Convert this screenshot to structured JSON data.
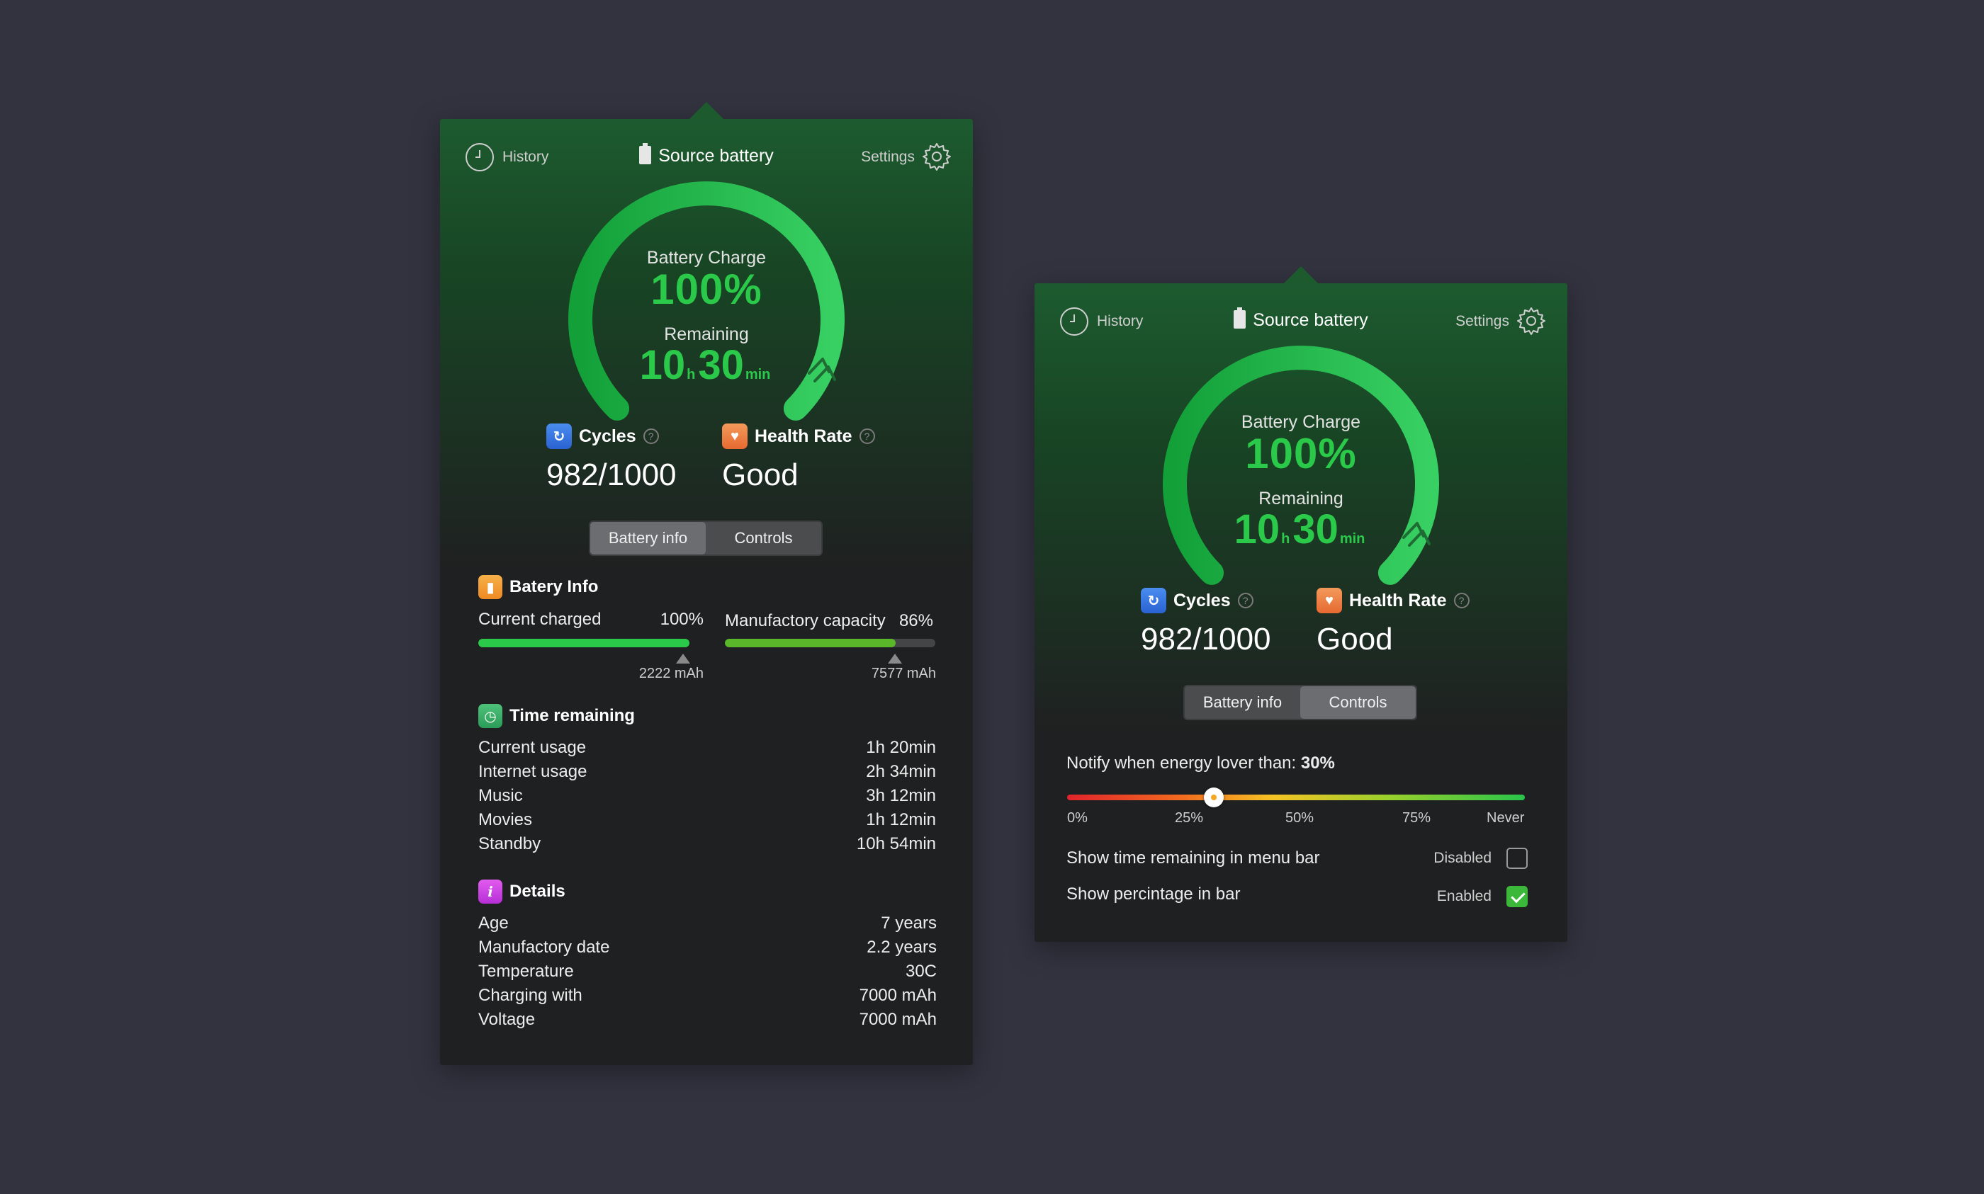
{
  "theme": {
    "accent_green": "#2bc94a",
    "background": "#32333f",
    "panel": "#1f2021",
    "header_green": "#1d5b2f"
  },
  "header": {
    "history_label": "History",
    "title": "Source battery",
    "settings_label": "Settings",
    "history_icon": "clock-icon",
    "title_icon": "battery-icon",
    "settings_icon": "gear-icon"
  },
  "gauge": {
    "charge_label": "Battery Charge",
    "charge_value": "100%",
    "charge_fraction": 1.0,
    "remaining_label": "Remaining",
    "hours": "10",
    "hours_unit": "h",
    "minutes": "30",
    "minutes_unit": "min"
  },
  "stats": {
    "cycles_label": "Cycles",
    "cycles_value": "982/1000",
    "cycles_icon": "cycles-icon",
    "health_label": "Health Rate",
    "health_value": "Good",
    "health_icon": "heart-icon",
    "help_glyph": "?"
  },
  "tabs": {
    "battery_info": "Battery info",
    "controls": "Controls"
  },
  "battery_info": {
    "title": "Batery Info",
    "current_charged_label": "Current charged",
    "current_charged_value": "100%",
    "current_charged_fraction": 1.0,
    "current_charged_mah": "2222 mAh",
    "capacity_label": "Manufactory capacity",
    "capacity_value": "86%",
    "capacity_fraction": 0.81,
    "capacity_mah": "7577 mAh"
  },
  "time_remaining": {
    "title": "Time remaining",
    "rows": [
      {
        "label": "Current usage",
        "value": "1h 20min"
      },
      {
        "label": "Internet usage",
        "value": "2h 34min"
      },
      {
        "label": "Music",
        "value": "3h 12min"
      },
      {
        "label": "Movies",
        "value": "1h 12min"
      },
      {
        "label": "Standby",
        "value": "10h 54min"
      }
    ]
  },
  "details": {
    "title": "Details",
    "info_glyph": "i",
    "rows": [
      {
        "label": "Age",
        "value": "7 years"
      },
      {
        "label": "Manufactory date",
        "value": "2.2 years"
      },
      {
        "label": "Temperature",
        "value": "30C"
      },
      {
        "label": "Charging with",
        "value": "7000 mAh"
      },
      {
        "label": "Voltage",
        "value": "7000 mAh"
      }
    ]
  },
  "controls": {
    "notify_prefix": "Notify when energy lover than: ",
    "notify_value": "30%",
    "notify_fraction": 0.32,
    "ticks": [
      "0%",
      "25%",
      "50%",
      "75%",
      "Never"
    ],
    "show_time_label": "Show time remaining in menu bar",
    "show_time_state": "Disabled",
    "show_time_checked": false,
    "show_percentage_label": "Show percintage in bar",
    "show_percentage_state": "Enabled",
    "show_percentage_checked": true
  }
}
